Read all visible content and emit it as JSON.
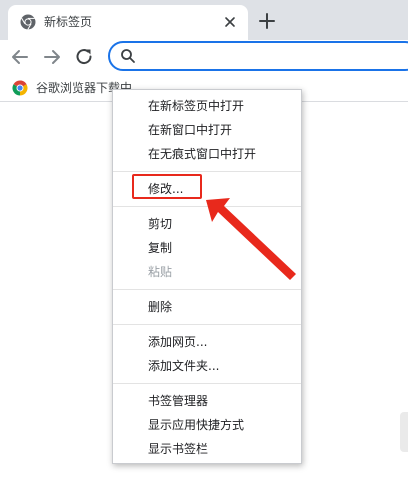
{
  "tab": {
    "title": "新标签页"
  },
  "bookmarks": [
    {
      "label": "谷歌浏览器下载中"
    }
  ],
  "menu": {
    "items": [
      {
        "label": "在新标签页中打开",
        "disabled": false
      },
      {
        "label": "在新窗口中打开",
        "disabled": false
      },
      {
        "label": "在无痕式窗口中打开",
        "disabled": false
      },
      {
        "label": "修改...",
        "disabled": false
      },
      {
        "label": "剪切",
        "disabled": false
      },
      {
        "label": "复制",
        "disabled": false
      },
      {
        "label": "粘贴",
        "disabled": true
      },
      {
        "label": "删除",
        "disabled": false
      },
      {
        "label": "添加网页...",
        "disabled": false
      },
      {
        "label": "添加文件夹...",
        "disabled": false
      },
      {
        "label": "书签管理器",
        "disabled": false
      },
      {
        "label": "显示应用快捷方式",
        "disabled": false
      },
      {
        "label": "显示书签栏",
        "disabled": false
      }
    ]
  },
  "colors": {
    "accent": "#1a73e8",
    "annotation": "#e8291c",
    "tabstrip": "#dee1e6"
  },
  "icons": {
    "favicon": "chrome-logo-icon",
    "close": "close-icon",
    "new_tab": "plus-icon",
    "back": "back-arrow-icon",
    "forward": "forward-arrow-icon",
    "reload": "reload-icon",
    "search": "search-icon"
  }
}
